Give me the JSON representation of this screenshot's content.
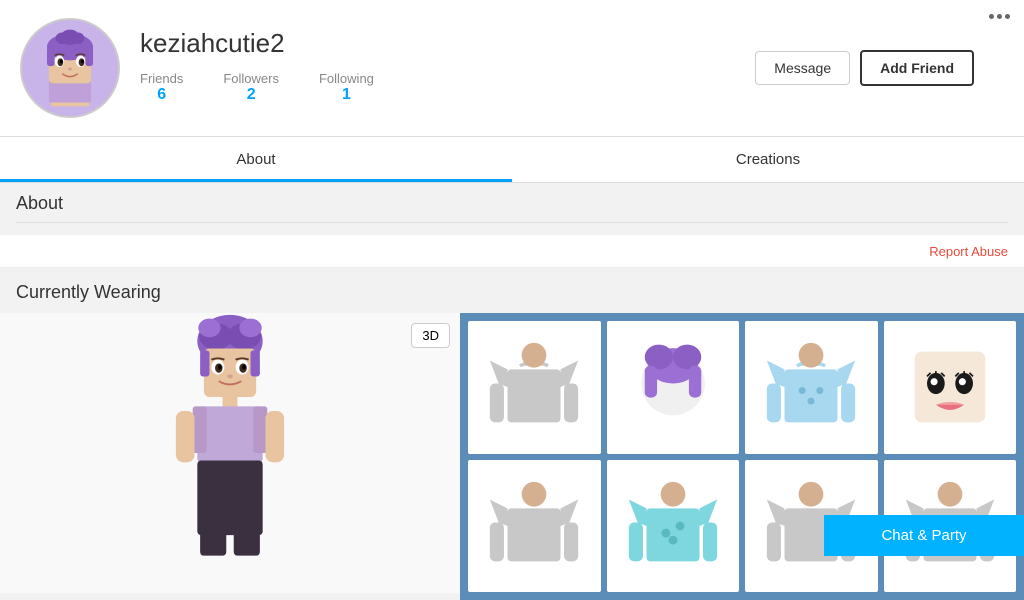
{
  "profile": {
    "username": "keziahcutie2",
    "stats": {
      "friends_label": "Friends",
      "friends_value": "6",
      "followers_label": "Followers",
      "followers_value": "2",
      "following_label": "Following",
      "following_value": "1"
    },
    "actions": {
      "message_label": "Message",
      "add_friend_label": "Add Friend"
    }
  },
  "tabs": [
    {
      "id": "about",
      "label": "About",
      "active": true
    },
    {
      "id": "creations",
      "label": "Creations",
      "active": false
    }
  ],
  "about": {
    "title": "About",
    "report_abuse_label": "Report Abuse"
  },
  "currently_wearing": {
    "title": "Currently Wearing",
    "btn_3d": "3D"
  },
  "chat_party": {
    "label": "Chat & Party"
  },
  "items": [
    {
      "id": 1,
      "type": "shirt",
      "color": "#c8c8c8"
    },
    {
      "id": 2,
      "type": "hair",
      "color": "#9b59b6"
    },
    {
      "id": 3,
      "type": "shirt2",
      "color": "#7ec8e3"
    },
    {
      "id": 4,
      "type": "face",
      "color": "#f5c5a3"
    },
    {
      "id": 5,
      "type": "pants",
      "color": "#c8c8c8"
    },
    {
      "id": 6,
      "type": "hat",
      "color": "#7ed6df"
    },
    {
      "id": 7,
      "type": "accessory",
      "color": "#c8c8c8"
    },
    {
      "id": 8,
      "type": "shoes",
      "color": "#c8c8c8"
    }
  ]
}
